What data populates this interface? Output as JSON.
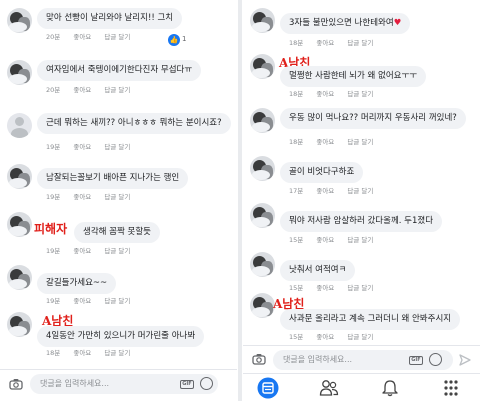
{
  "meta_labels": {
    "like": "좋아요",
    "reply": "답글 달기"
  },
  "left": {
    "comments": [
      {
        "text": "맞아 선빵이 날리와야 날리지!! 그치",
        "time": "20분",
        "likes": "1"
      },
      {
        "text": "여자임에서 죽텡이에기한다진자 무섭다ㅠ",
        "time": "20분"
      },
      {
        "text": "근데 뭐하는 새끼?? 아니ㅎㅎㅎ 뭐하는 분이시죠?",
        "time": "19분"
      },
      {
        "text": "남잘되는꼴보기 배아픈 지나가는 행인",
        "time": "19분"
      },
      {
        "text": "생각해 꼼짝 못할듯",
        "time": "19분",
        "tag": "피해자"
      },
      {
        "text": "갈길들가세요~~",
        "time": "19분"
      },
      {
        "text": "4일동안 가만히 있으니가 머가린줄 아나봐",
        "time": "18분",
        "tag": "A남친"
      }
    ],
    "composer_placeholder": "댓글을 입력하세요...",
    "gif": "GIF"
  },
  "right": {
    "comments": [
      {
        "text": "3자들 불만있으면 나한테와여",
        "heart": "♥",
        "time": "18분"
      },
      {
        "text": "멀쩡한 사람한테 뇌가 왜 없어요ㅜㅜ",
        "time": "18분",
        "tag": "A남친"
      },
      {
        "text": "우동 많이 먹나요?? 머리까지 우동사리 꺼있네?",
        "time": "18분"
      },
      {
        "text": "골이 비엇다구하죠",
        "time": "17분"
      },
      {
        "text": "뭐야 저사람 암살하러 갔다올께. 두1졌다",
        "time": "15분"
      },
      {
        "text": "낫춰서 여적여ㅋ",
        "time": "15분"
      },
      {
        "text": "사과문 올리라고 계속 그러더니 왜 안봐주시지",
        "time": "15분",
        "tag": "A남친"
      }
    ],
    "composer_placeholder": "댓글을 입력하세요...",
    "gif": "GIF"
  },
  "colors": {
    "accent": "#1877f2",
    "tag": "#e0201b",
    "bubble": "#f0f2f5"
  },
  "icons": {
    "composer": [
      "camera-icon",
      "gif-icon",
      "emoji-icon",
      "send-icon"
    ],
    "tabbar": [
      "news-feed-icon",
      "friends-icon",
      "notifications-icon",
      "menu-grid-icon"
    ]
  }
}
